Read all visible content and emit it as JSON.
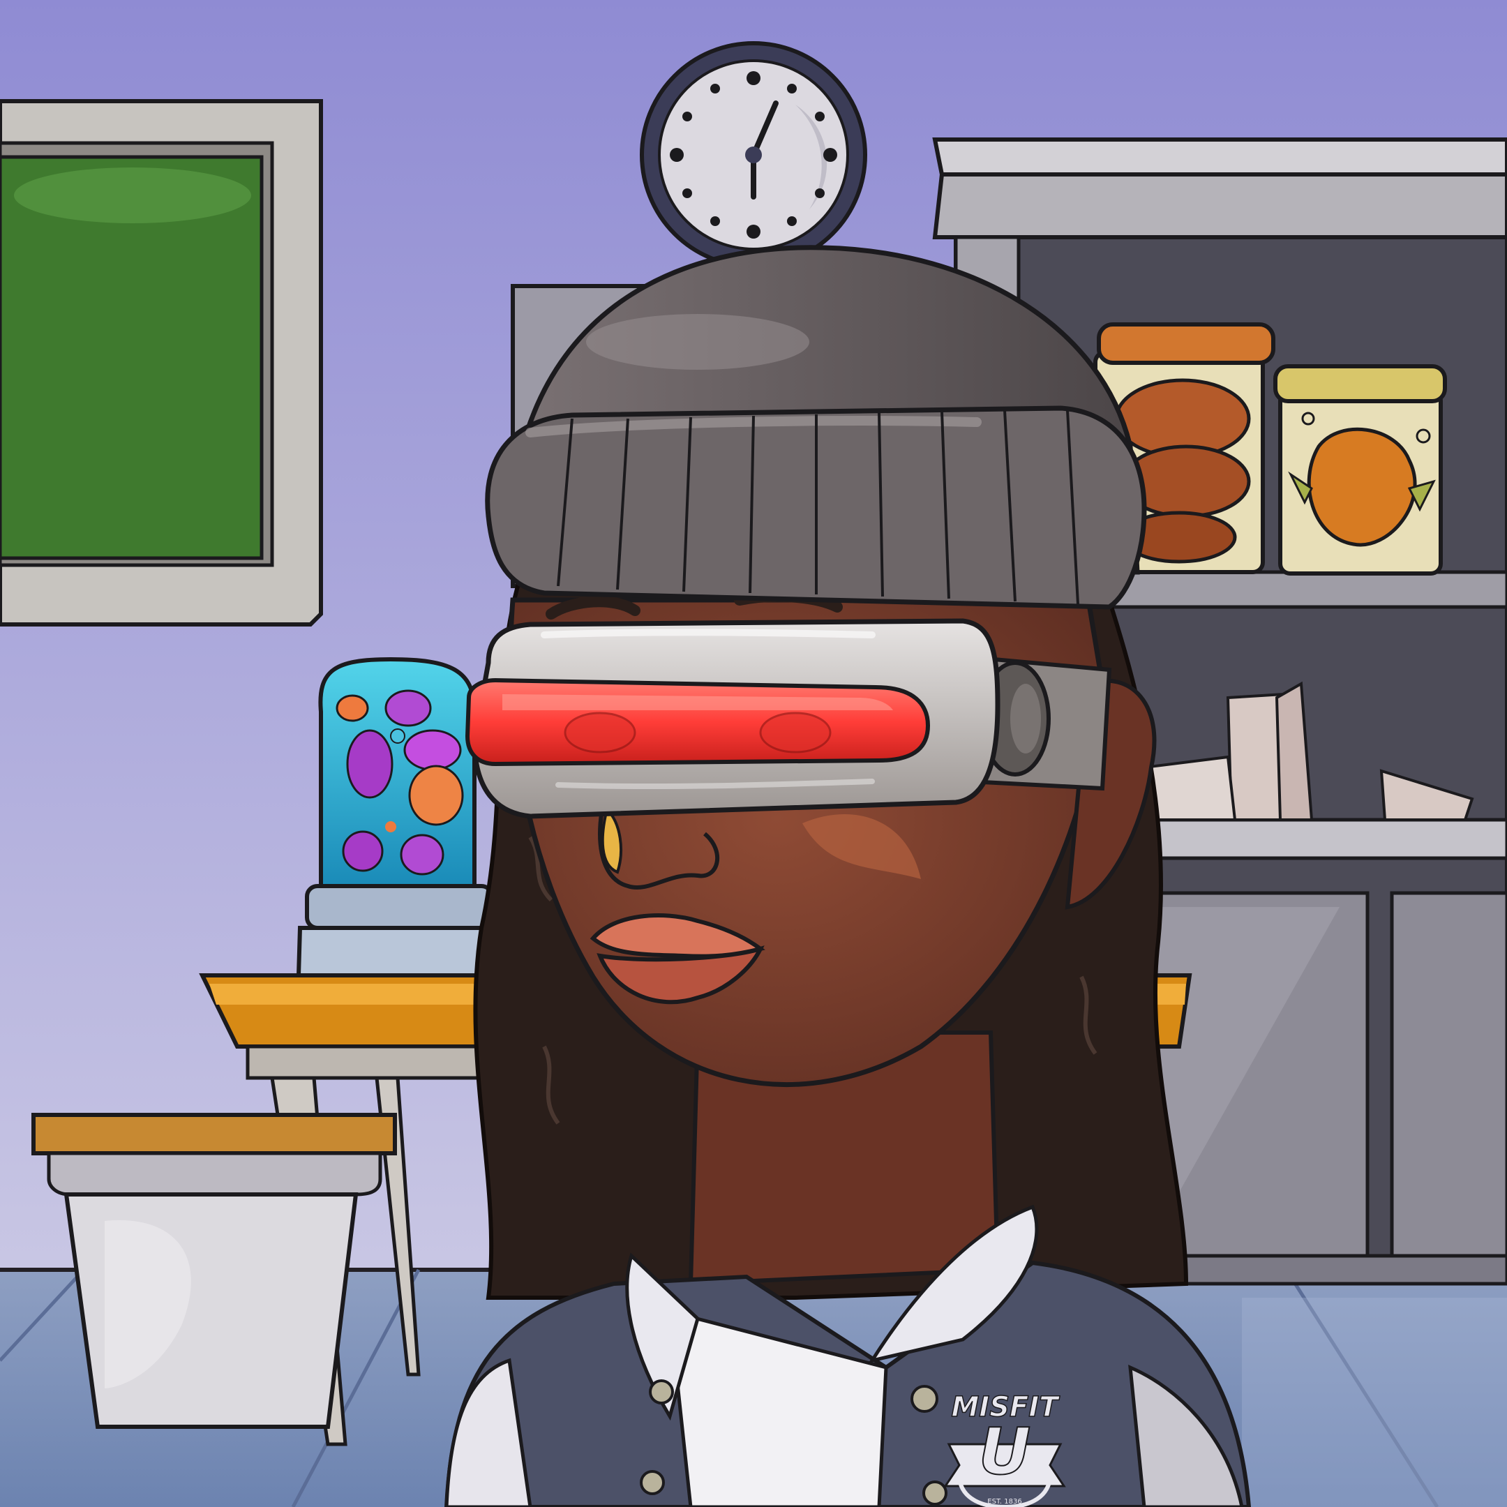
{
  "scene": {
    "logo": {
      "line1": "MISFIT",
      "letter": "U",
      "est": "EST. 1836"
    },
    "colors": {
      "wall_top": "#8f8bd3",
      "wall_bottom": "#c9c7e4",
      "floor": "#8e9fc2",
      "chalkboard": "#3f7a2e",
      "beanie": "#5e5759",
      "visor_lens": "#ff4b45",
      "skin": "#7a3f2e",
      "hair": "#2a1e1a",
      "jacket": "#4c5168",
      "lava_liquid": "#2ab0cf",
      "desk_top": "#d78a15"
    },
    "icons": [
      "wall-clock-icon",
      "visor-icon",
      "lava-lamp-icon",
      "specimen-jar-icon",
      "school-logo-icon"
    ]
  }
}
